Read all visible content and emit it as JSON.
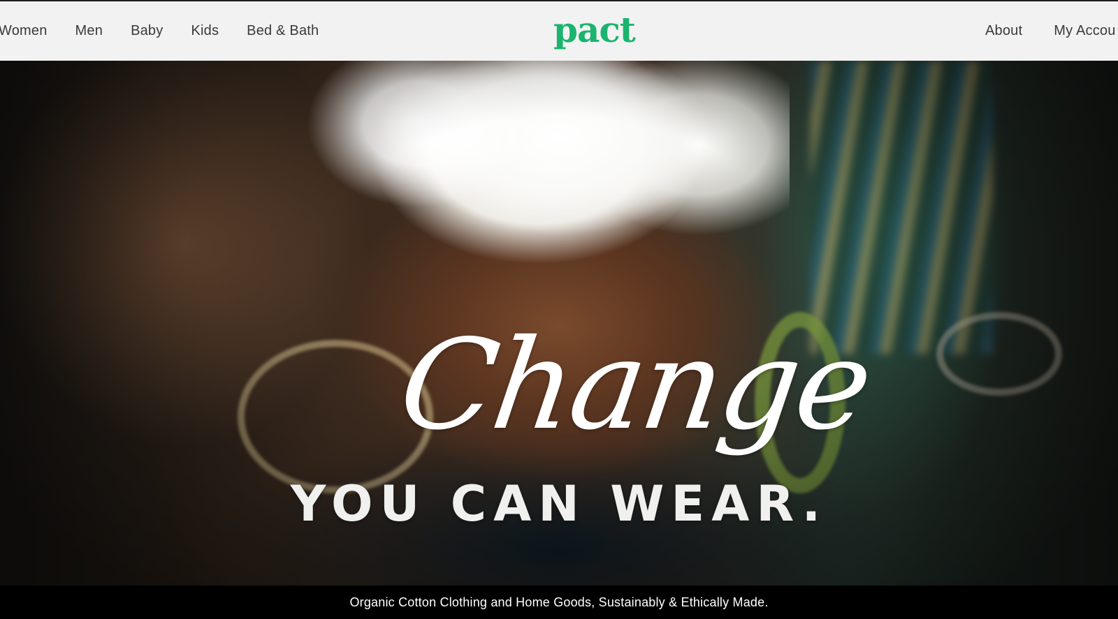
{
  "nav": {
    "left_items": [
      "Women",
      "Men",
      "Baby",
      "Kids",
      "Bed & Bath"
    ],
    "right_items": [
      "About",
      "My Accou"
    ]
  },
  "logo": {
    "text": "pact",
    "color": "#1bb46f"
  },
  "hero": {
    "script_headline": "Change",
    "tagline": "YOU CAN WEAR."
  },
  "footer_strip": {
    "text": "Organic Cotton Clothing and Home Goods, Sustainably & Ethically Made."
  }
}
